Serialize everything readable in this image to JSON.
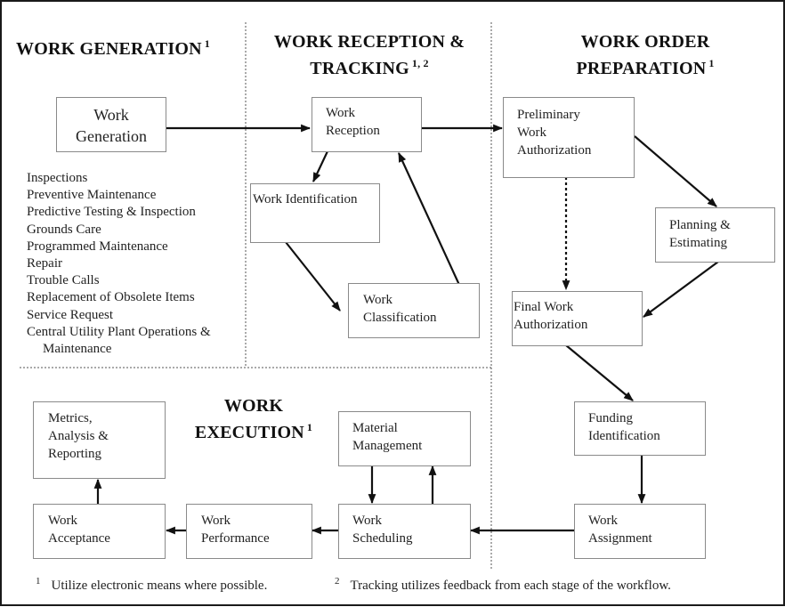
{
  "sections": {
    "work_generation": {
      "title": "WORK GENERATION",
      "note": "1"
    },
    "work_reception": {
      "title_line1": "WORK RECEPTION &",
      "title_line2": "TRACKING",
      "note": "1, 2"
    },
    "work_order_prep": {
      "title_line1": "WORK ORDER",
      "title_line2": "PREPARATION",
      "note": "1"
    },
    "work_execution": {
      "title_line1": "WORK",
      "title_line2": "EXECUTION",
      "note": "1"
    }
  },
  "boxes": {
    "work_generation": "Work\nGeneration",
    "work_reception": "Work\nReception",
    "work_identification": "Work Identification",
    "work_classification": "Work\nClassification",
    "preliminary_work_authorization": "Preliminary\nWork\nAuthorization",
    "planning_estimating": "Planning &\nEstimating",
    "final_work_authorization": "Final Work\nAuthorization",
    "funding_identification": "Funding\nIdentification",
    "work_assignment": "Work\nAssignment",
    "work_scheduling": "Work\nScheduling",
    "material_management": "Material\nManagement",
    "work_performance": "Work\nPerformance",
    "work_acceptance": "Work\nAcceptance",
    "metrics_reporting": "Metrics,\nAnalysis &\nReporting"
  },
  "work_generation_sources": [
    "Inspections",
    "Preventive Maintenance",
    "Predictive Testing & Inspection",
    "Grounds Care",
    "Programmed Maintenance",
    "Repair",
    "Trouble Calls",
    "Replacement of Obsolete Items",
    "Service Request",
    "Central Utility Plant Operations &",
    "Maintenance"
  ],
  "footnotes": [
    {
      "mark": "1",
      "text": "Utilize electronic means where possible."
    },
    {
      "mark": "2",
      "text": "Tracking utilizes feedback from each stage of the workflow."
    }
  ],
  "connections": [
    {
      "from": "work_generation",
      "to": "work_reception",
      "style": "solid"
    },
    {
      "from": "work_reception",
      "to": "preliminary_work_authorization",
      "style": "solid"
    },
    {
      "from": "work_reception",
      "to": "work_identification",
      "style": "solid"
    },
    {
      "from": "work_identification",
      "to": "work_classification",
      "style": "solid"
    },
    {
      "from": "work_classification",
      "to": "work_reception",
      "style": "solid"
    },
    {
      "from": "preliminary_work_authorization",
      "to": "planning_estimating",
      "style": "solid"
    },
    {
      "from": "preliminary_work_authorization",
      "to": "final_work_authorization",
      "style": "dotted"
    },
    {
      "from": "planning_estimating",
      "to": "final_work_authorization",
      "style": "solid"
    },
    {
      "from": "final_work_authorization",
      "to": "funding_identification",
      "style": "solid"
    },
    {
      "from": "funding_identification",
      "to": "work_assignment",
      "style": "solid"
    },
    {
      "from": "work_assignment",
      "to": "work_scheduling",
      "style": "solid"
    },
    {
      "from": "work_scheduling",
      "to": "material_management",
      "style": "solid"
    },
    {
      "from": "material_management",
      "to": "work_scheduling",
      "style": "solid"
    },
    {
      "from": "work_scheduling",
      "to": "work_performance",
      "style": "solid"
    },
    {
      "from": "work_performance",
      "to": "work_acceptance",
      "style": "solid"
    },
    {
      "from": "work_acceptance",
      "to": "metrics_reporting",
      "style": "solid"
    }
  ]
}
